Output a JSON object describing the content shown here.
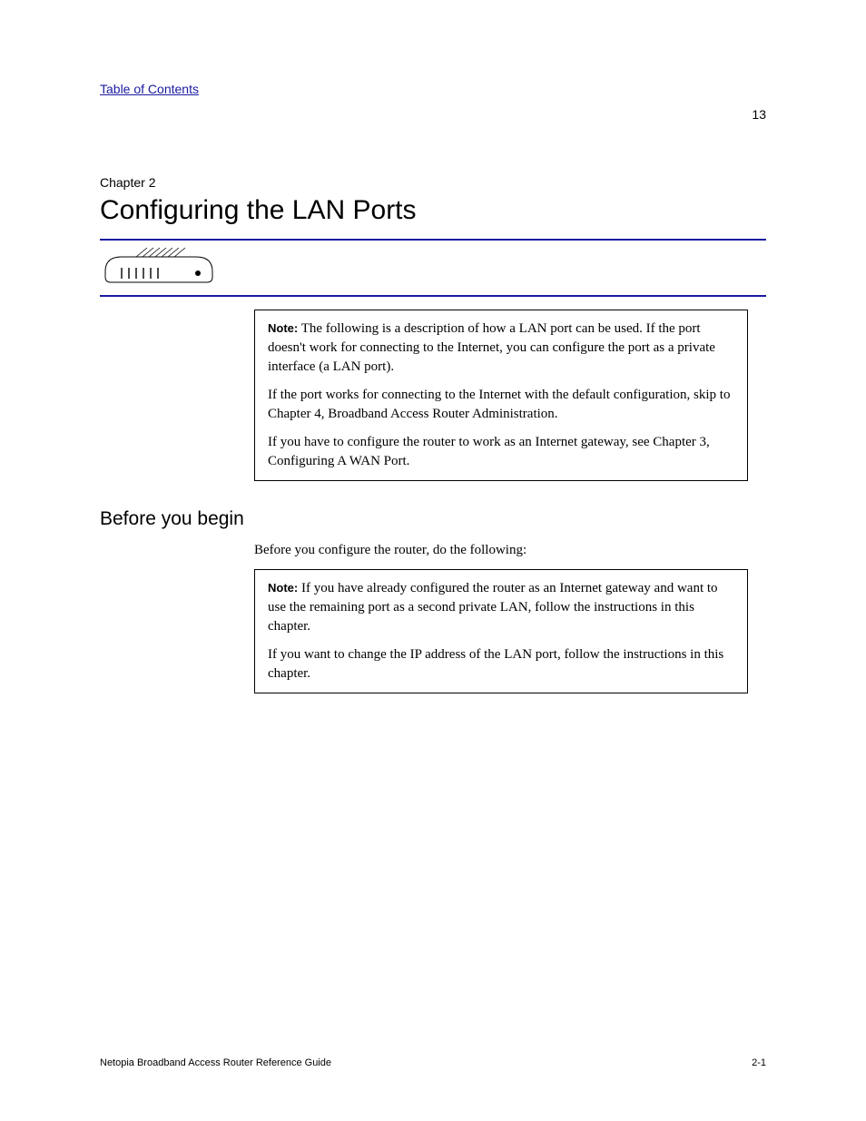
{
  "header": {
    "breadcrumb_link": "Table of Contents",
    "page_num_top": "13"
  },
  "chapter": {
    "line": "Chapter 2",
    "title": "Configuring the LAN Ports"
  },
  "intro": {
    "note_label": "Note:",
    "para1": "The following is a description of how a LAN port can be used. If the port doesn't work for connecting to the Internet, you can configure the port as a private interface (a LAN port).",
    "para2": "If the port works for connecting to the Internet with the default configuration, skip to Chapter 4, Broadband Access Router Administration.",
    "para3": "If you have to configure the router to work as an Internet gateway, see Chapter 3, Configuring A WAN Port."
  },
  "section": {
    "heading": "Before you begin",
    "lead": "Before you configure the router, do the following:",
    "note_label": "Note:",
    "box_para1": "If you have already configured the router as an Internet gateway and want to use the remaining port as a second private LAN, follow the instructions in this chapter.",
    "box_para2": "If you want to change the IP address of the LAN port, follow the instructions in this chapter."
  },
  "footer": {
    "left": "Netopia Broadband Access Router Reference Guide",
    "right": "2-1"
  }
}
